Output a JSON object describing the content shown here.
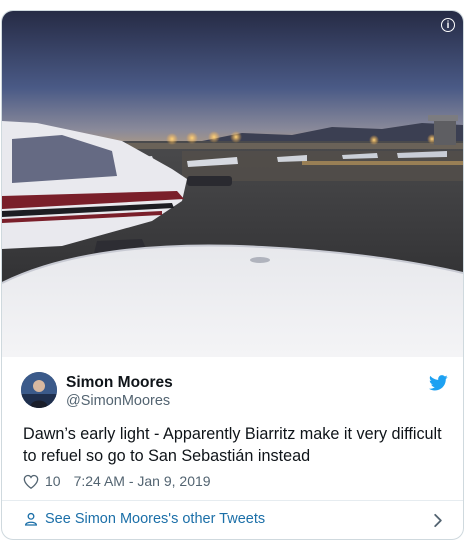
{
  "tweet": {
    "author_name": "Simon Moores",
    "author_handle": "@SimonMoores",
    "text": "Dawn’s early light - Apparently Biarritz make it very difficult to refuel so go to San Sebastián instead",
    "like_count": "10",
    "timestamp": "7:24 AM - Jan 9, 2019",
    "info_icon_glyph": "i"
  },
  "footer": {
    "other_tweets_label": "See Simon Moores's other Tweets"
  },
  "icons": {
    "info": "info-icon",
    "twitter": "twitter-bird-icon",
    "like": "heart-icon",
    "profile": "person-icon",
    "more": "chevron-right-icon"
  },
  "colors": {
    "twitter_blue": "#1da1f2",
    "link_blue": "#1b6fa8",
    "text_primary": "#0f1419",
    "text_secondary": "#536471"
  }
}
